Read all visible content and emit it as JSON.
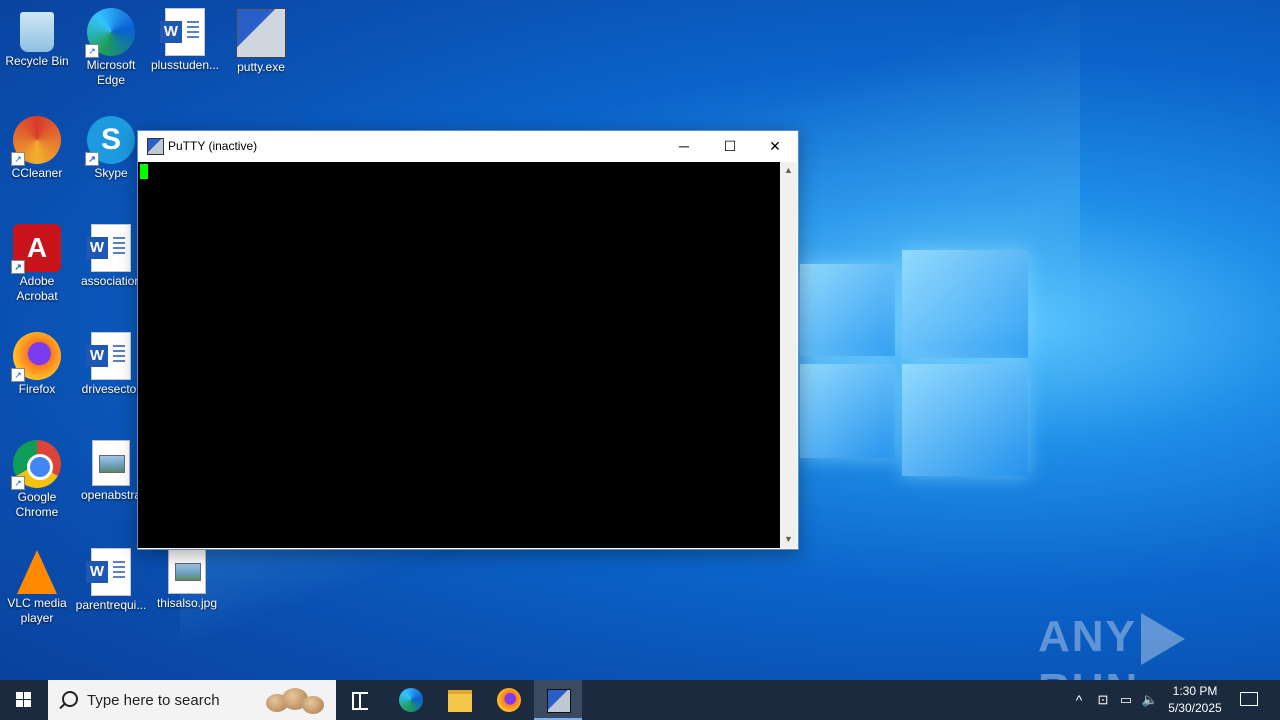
{
  "desktop": {
    "icons": [
      {
        "label": "Recycle Bin"
      },
      {
        "label": "Microsoft Edge"
      },
      {
        "label": "plusstuden..."
      },
      {
        "label": "putty.exe"
      },
      {
        "label": "CCleaner"
      },
      {
        "label": "Skype"
      },
      {
        "label": "Adobe Acrobat"
      },
      {
        "label": "association"
      },
      {
        "label": "Firefox"
      },
      {
        "label": "drivesector"
      },
      {
        "label": "Google Chrome"
      },
      {
        "label": "openabstra"
      },
      {
        "label": "VLC media player"
      },
      {
        "label": "parentrequi..."
      },
      {
        "label": "thisalso.jpg"
      }
    ]
  },
  "window": {
    "title": "PuTTY (inactive)",
    "minimize": "─",
    "maximize": "☐",
    "close": "✕",
    "cursor_color": "#00ff00"
  },
  "watermark": {
    "left": "ANY",
    "right": "RUN"
  },
  "taskbar": {
    "search_placeholder": "Type here to search",
    "tray_chevron": "^",
    "clock_time": "1:30 PM",
    "clock_date": "5/30/2025"
  },
  "colors": {
    "taskbar": "#1b2a3e",
    "terminal_bg": "#000000",
    "desktop_accent": "#0b63c9"
  }
}
